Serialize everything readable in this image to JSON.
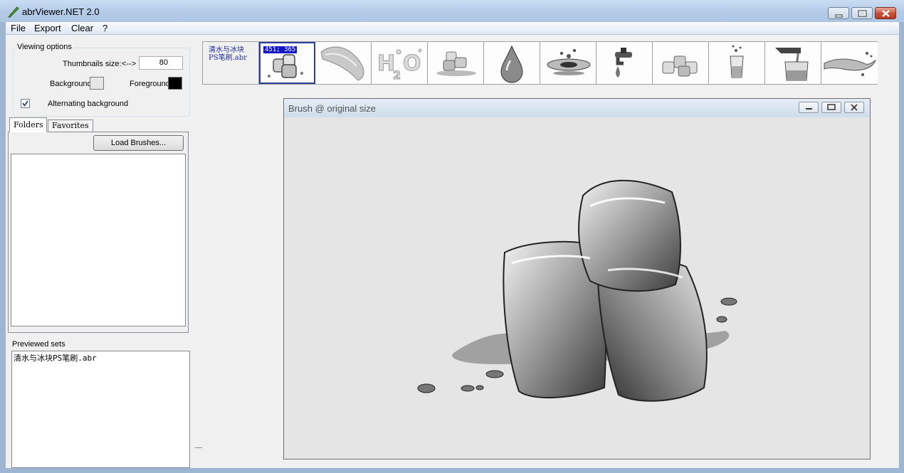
{
  "window": {
    "title": "abrViewer.NET 2.0"
  },
  "menu": [
    "File",
    "Export",
    "Clear",
    "?"
  ],
  "viewing_options": {
    "legend": "Viewing options",
    "thumb_size_label": "Thumbnails size:",
    "thumb_size_arrow": "<-->",
    "thumb_size_value": "80",
    "background_label": "Background:",
    "foreground_label": "Foreground:",
    "background_color": "#e6e6e6",
    "foreground_color": "#000000",
    "alternating_label": "Alternating background",
    "alternating_checked": true
  },
  "tabs": {
    "folders": "Folders",
    "favorites": "Favorites"
  },
  "load_button": "Load Brushes...",
  "previewed_sets": {
    "label": "Previewed sets",
    "items": [
      "清水与冰块PS笔刷.abr"
    ]
  },
  "thumbnails": {
    "set_name_line1": "清水与冰块",
    "set_name_line2": "PS笔刷.abr",
    "selected_size": "451; 365",
    "icons": [
      "ice-cubes-icon",
      "water-wave-icon",
      "h2o-icon",
      "ice-splash-icon",
      "water-drop-icon",
      "splash-crown-icon",
      "faucet-icon",
      "ice-cubes-group-icon",
      "glass-splash-icon",
      "pouring-glass-icon",
      "water-spray-icon"
    ]
  },
  "brush_window": {
    "title": "Brush @ original size",
    "preview_icon": "ice-cubes-icon"
  }
}
